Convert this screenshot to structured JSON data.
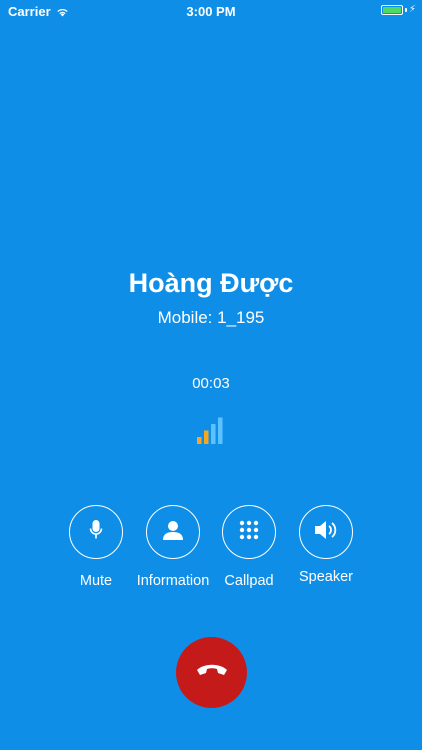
{
  "status_bar": {
    "carrier": "Carrier",
    "time": "3:00 PM",
    "battery_color": "#4cd964"
  },
  "contact": {
    "name": "Hoàng Được",
    "number": "Mobile: 1_195"
  },
  "call": {
    "timer": "00:03",
    "signal_bars_total": 4,
    "signal_bars_strong": 2
  },
  "actions": {
    "mute": {
      "label": "Mute",
      "icon": "microphone-icon"
    },
    "information": {
      "label": "Information",
      "icon": "person-icon"
    },
    "callpad": {
      "label": "Callpad",
      "icon": "keypad-icon"
    },
    "speaker": {
      "label": "Speaker",
      "icon": "speaker-icon"
    }
  },
  "end_call": {
    "icon": "phone-hangup-icon",
    "color": "#c51a1a"
  },
  "colors": {
    "background": "#0f8ee8",
    "signal_active": "#f5a623",
    "signal_inactive": "#5cc2ff"
  }
}
